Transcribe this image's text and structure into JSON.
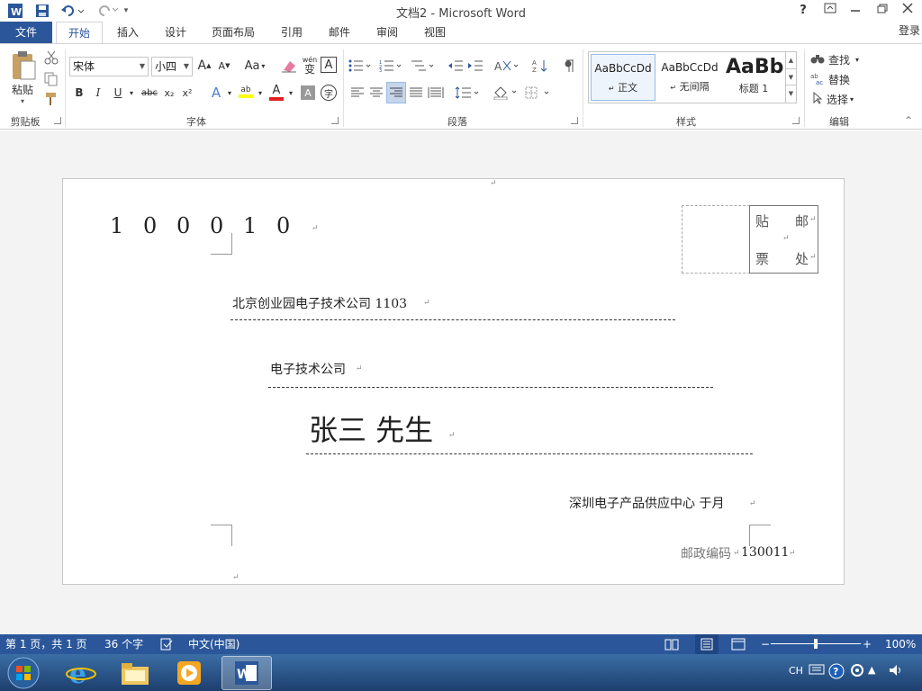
{
  "app": {
    "title": "文档2 - Microsoft Word",
    "help": "?",
    "login": "登录"
  },
  "tabs": [
    "文件",
    "开始",
    "插入",
    "设计",
    "页面布局",
    "引用",
    "邮件",
    "审阅",
    "视图"
  ],
  "ribbon": {
    "clipboard": {
      "paste": "粘贴",
      "label": "剪贴板"
    },
    "font": {
      "name": "宋体",
      "size": "小四",
      "label": "字体",
      "grow": "A",
      "shrink": "A",
      "case": "Aa",
      "phonetic_top": "wén",
      "phonetic_bottom": "变",
      "border_char": "A",
      "bold": "B",
      "italic": "I",
      "underline": "U",
      "strike": "abc",
      "sub": "x₂",
      "sup": "x²",
      "effects": "A",
      "highlight": "ab",
      "color": "A",
      "shading": "A",
      "enclose": "字"
    },
    "paragraph": {
      "label": "段落"
    },
    "styles": {
      "label": "样式",
      "items": [
        {
          "preview": "AaBbCcDd",
          "name": "正文"
        },
        {
          "preview": "AaBbCcDd",
          "name": "无间隔"
        },
        {
          "preview": "AaBbl",
          "name": "标题 1"
        }
      ]
    },
    "editing": {
      "find": "查找",
      "replace": "替换",
      "select": "选择",
      "label": "编辑"
    }
  },
  "document": {
    "postcode_digits": [
      "1",
      "0",
      "0",
      "0",
      "1",
      "0"
    ],
    "stamp_top_left": "贴",
    "stamp_top_right": "邮",
    "stamp_bottom_left": "票",
    "stamp_bottom_right": "处",
    "address": "北京创业园电子技术公司 1103",
    "company": "电子技术公司",
    "recipient": "张三 先生",
    "sender": "深圳电子产品供应中心  于月",
    "sender_postcode_label": "邮政编码",
    "sender_postcode": "130011"
  },
  "status": {
    "page": "第 1 页，共 1 页",
    "words": "36 个字",
    "language": "中文(中国)",
    "zoom": "100%",
    "zoom_level": 1.0
  },
  "tray": {
    "lang": "CH"
  },
  "colors": {
    "accent": "#2b579a"
  }
}
